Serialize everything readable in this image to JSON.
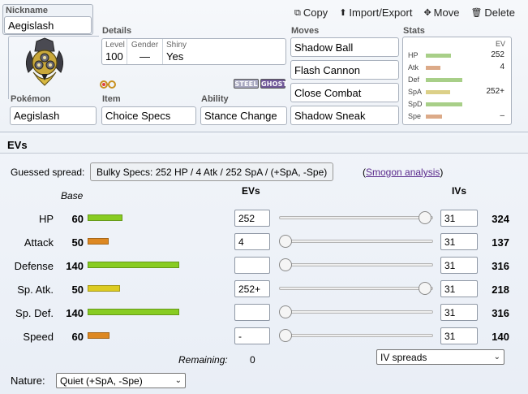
{
  "header": {
    "nickname_label": "Nickname",
    "nickname_value": "Aegislash",
    "actions": [
      {
        "icon": "copy-icon",
        "glyph": "⧉",
        "label": "Copy"
      },
      {
        "icon": "import-export-icon",
        "glyph": "⬆",
        "label": "Import/Export"
      },
      {
        "icon": "move-icon",
        "glyph": "✥",
        "label": "Move"
      },
      {
        "icon": "trash-icon",
        "glyph": "🗑",
        "label": "Delete"
      }
    ]
  },
  "details": {
    "label": "Details",
    "level_label": "Level",
    "level_value": "100",
    "gender_label": "Gender",
    "gender_value": "—",
    "shiny_label": "Shiny",
    "shiny_value": "Yes"
  },
  "types": [
    {
      "name": "STEEL",
      "color": "#a8a8c0"
    },
    {
      "name": "GHOST",
      "color": "#705898"
    }
  ],
  "pokemon": {
    "label": "Pokémon",
    "value": "Aegislash"
  },
  "item": {
    "label": "Item",
    "value": "Choice Specs"
  },
  "ability": {
    "label": "Ability",
    "value": "Stance Change"
  },
  "moves": {
    "label": "Moves",
    "list": [
      "Shadow Ball",
      "Flash Cannon",
      "Close Combat",
      "Shadow Sneak"
    ]
  },
  "stats_summary": {
    "label": "Stats",
    "ev_label": "EV",
    "rows": [
      {
        "abbr": "HP",
        "ev": "252",
        "bar_fraction": 0.35,
        "color": "#a8cf88"
      },
      {
        "abbr": "Atk",
        "ev": "4",
        "bar_fraction": 0.2,
        "color": "#dcaa88"
      },
      {
        "abbr": "Def",
        "ev": "",
        "bar_fraction": 0.5,
        "color": "#a8cf88"
      },
      {
        "abbr": "SpA",
        "ev": "252+",
        "bar_fraction": 0.33,
        "color": "#dcd088"
      },
      {
        "abbr": "SpD",
        "ev": "",
        "bar_fraction": 0.5,
        "color": "#a8cf88"
      },
      {
        "abbr": "Spe",
        "ev": "–",
        "bar_fraction": 0.22,
        "color": "#dcaa88"
      }
    ]
  },
  "evs_section": {
    "title": "EVs",
    "guessed_spread_label": "Guessed spread:",
    "guessed_spread_value": "Bulky Specs: 252 HP / 4 Atk / 252 SpA / (+SpA, -Spe)",
    "smogon_prefix": "(",
    "smogon_link": "Smogon analysis",
    "smogon_suffix": ")",
    "base_header": "Base",
    "evs_header": "EVs",
    "ivs_header": "IVs",
    "remaining_label": "Remaining:",
    "remaining_value": "0",
    "iv_spreads": "IV spreads",
    "nature_label": "Nature:",
    "nature_value": "Quiet (+SpA, -Spe)"
  },
  "stat_rows": [
    {
      "name": "HP",
      "base": "60",
      "base_fraction": 0.38,
      "bar_color": "#88cc22",
      "ev": "252",
      "slider_fraction": 1.0,
      "iv": "31",
      "total": "324"
    },
    {
      "name": "Attack",
      "base": "50",
      "base_fraction": 0.23,
      "bar_color": "#dd8822",
      "ev": "4",
      "slider_fraction": 0.0,
      "iv": "31",
      "total": "137"
    },
    {
      "name": "Defense",
      "base": "140",
      "base_fraction": 1.0,
      "bar_color": "#88cc22",
      "ev": "",
      "slider_fraction": 0.0,
      "iv": "31",
      "total": "316"
    },
    {
      "name": "Sp. Atk.",
      "base": "50",
      "base_fraction": 0.35,
      "bar_color": "#ddcc22",
      "ev": "252+",
      "slider_fraction": 1.0,
      "iv": "31",
      "total": "218"
    },
    {
      "name": "Sp. Def.",
      "base": "140",
      "base_fraction": 1.0,
      "bar_color": "#88cc22",
      "ev": "",
      "slider_fraction": 0.0,
      "iv": "31",
      "total": "316"
    },
    {
      "name": "Speed",
      "base": "60",
      "base_fraction": 0.24,
      "bar_color": "#dd8822",
      "ev": "-",
      "slider_fraction": 0.0,
      "iv": "31",
      "total": "140"
    }
  ]
}
